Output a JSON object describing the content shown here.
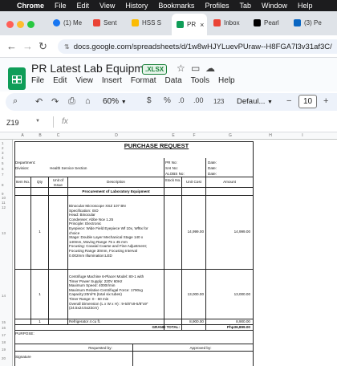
{
  "menubar": {
    "apple": "",
    "app": "Chrome",
    "items": [
      "File",
      "Edit",
      "View",
      "History",
      "Bookmarks",
      "Profiles",
      "Tab",
      "Window",
      "Help"
    ]
  },
  "tabs": [
    {
      "label": "(1) Me",
      "icon": "facebook-icon",
      "color": "#1877f2"
    },
    {
      "label": "Sent",
      "icon": "gmail-icon",
      "color": "#ea4335"
    },
    {
      "label": "HSS S",
      "icon": "drive-icon",
      "color": "#fbbc04"
    },
    {
      "label": "PR",
      "icon": "sheets-icon",
      "color": "#0f9d58",
      "active": true
    },
    {
      "label": "Inbox",
      "icon": "gmail-icon",
      "color": "#ea4335"
    },
    {
      "label": "Pearl",
      "icon": "x-icon",
      "color": "#000000"
    },
    {
      "label": "(3) Pe",
      "icon": "linkedin-icon",
      "color": "#0a66c2"
    }
  ],
  "address": {
    "url": "docs.google.com/spreadsheets/d/1w8wHJYLuevPUraw--H8FGA7l3v31af3C/"
  },
  "doc": {
    "title": "PR Latest Lab Equipment",
    "badge": ".XLSX",
    "menus": [
      "File",
      "Edit",
      "View",
      "Insert",
      "Format",
      "Data",
      "Tools",
      "Help"
    ]
  },
  "toolbar": {
    "zoom": "60%",
    "currency": "$",
    "percent": "%",
    "dec_decrease": ".0",
    "dec_increase": ".00",
    "num_format": "123",
    "font": "Defaul...",
    "font_size": "10",
    "minus": "−",
    "plus": "+"
  },
  "formula_bar": {
    "cell_ref": "Z19",
    "fx": "fx",
    "value": ""
  },
  "columns": [
    "A",
    "B",
    "C",
    "D",
    "E",
    "F",
    "G",
    "H",
    "I"
  ],
  "rows": [
    "1",
    "2",
    "3",
    "4",
    "5",
    "6",
    "7",
    "8",
    "9",
    "10",
    "11",
    "12",
    "13",
    "14",
    "15",
    "16",
    "17",
    "18",
    "19",
    "20"
  ],
  "sheet": {
    "title": "PURCHASE REQUEST",
    "department_label": "Department:",
    "division_label": "Division:",
    "division_value": "Health Service Section",
    "pr_no": "PR No:",
    "sai_no": "SAI No:",
    "alobs_no": "ALOBS No:",
    "date": "Date:",
    "headers": {
      "item_no": "Item No.",
      "qty": "Qty",
      "unit": "Unit of Issue",
      "description": "Description",
      "stock_no": "Stock No.",
      "unit_cost": "Unit Cost",
      "amount": "Amount"
    },
    "section_title": "Procurement of Laboratory Equipment",
    "items": [
      {
        "qty": "1",
        "description": [
          "Binocular Microscope XSZ 107 BN",
          "Specification: ISO",
          "Head: Binocular",
          "Condenser: Abbe Nov 1.25",
          "Principle: Electronic",
          "Eyepiece: Wide Field Eyepiece Wf 10x, Wf6x for",
          "choice",
          "Stage: Double Layer Mechanical Stage 140 x",
          "140mm, Moving Range 75 x 45 mm",
          "Focusing: Coaxial Coarse and Fine Adjustment;",
          "Focusing Range 30mm, Focusing Interval",
          "0.002mm        Illumination:LED"
        ],
        "unit_cost": "14,999.00",
        "amount": "14,999.00"
      },
      {
        "qty": "1",
        "description": [
          "Centrifuge Machine 6-Placer Model: 80-1 with",
          "Timer          Power Supply: 220V 60Hz",
          "Maximum Speed: 4000r/min",
          "Maximum Relative Centrifugal Force: 1790xg",
          "Capacity:20ml*6 (total six tubes)",
          "Timer Range: 0 - 60 min",
          "Overall Dimension (L x W x H) : 9-5/8\"x9-5/8\"x9\"",
          "(24.5x24.5x23cm)"
        ],
        "unit_cost": "13,000.00",
        "amount": "13,000.00"
      },
      {
        "qty": "1",
        "description": [
          "Refrigerator 4 cu ft."
        ],
        "unit_cost": "8,900.00",
        "amount": "8,900.00"
      }
    ],
    "grand_total_label": "GRAND TOTAL:",
    "grand_total": "Php36,899.00",
    "purpose_label": "PURPOSE:",
    "requested_by": "Requested by:",
    "approved_by": "Approved by:",
    "signature": "Signature"
  }
}
